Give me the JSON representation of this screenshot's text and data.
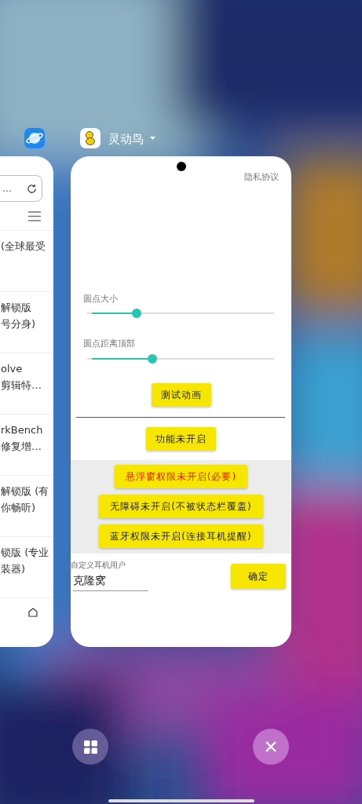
{
  "side_app": {
    "search_text": "…",
    "items": [
      {
        "lines": [
          "(全球最受"
        ]
      },
      {
        "lines": [
          "解锁版",
          "号分身)"
        ]
      },
      {
        "lines": [
          "olve",
          "剪辑特…"
        ]
      },
      {
        "lines": [
          "rkBench",
          "修复增…"
        ]
      },
      {
        "lines": [
          "解锁版 (有",
          "你畅听)"
        ]
      },
      {
        "lines": [
          "锁版 (专业",
          "装器)"
        ]
      }
    ]
  },
  "main_app": {
    "title": "灵动鸟",
    "privacy_link": "隐私协议",
    "sliders": [
      {
        "label": "圆点大小",
        "level": 0.25
      },
      {
        "label": "圆点距离顶部",
        "level": 0.34
      }
    ],
    "test_button": "测试动画",
    "function_button": "功能未开启",
    "permissions": [
      {
        "label": "悬浮窗权限未开启(必要)",
        "required": true
      },
      {
        "label": "无障碍未开启(不被状态栏覆盖)",
        "required": false
      },
      {
        "label": "蓝牙权限未开启(连接耳机提醒)",
        "required": false
      }
    ],
    "custom_user": {
      "label": "自定义耳机用户",
      "value": "克隆窝",
      "confirm": "确定"
    }
  }
}
